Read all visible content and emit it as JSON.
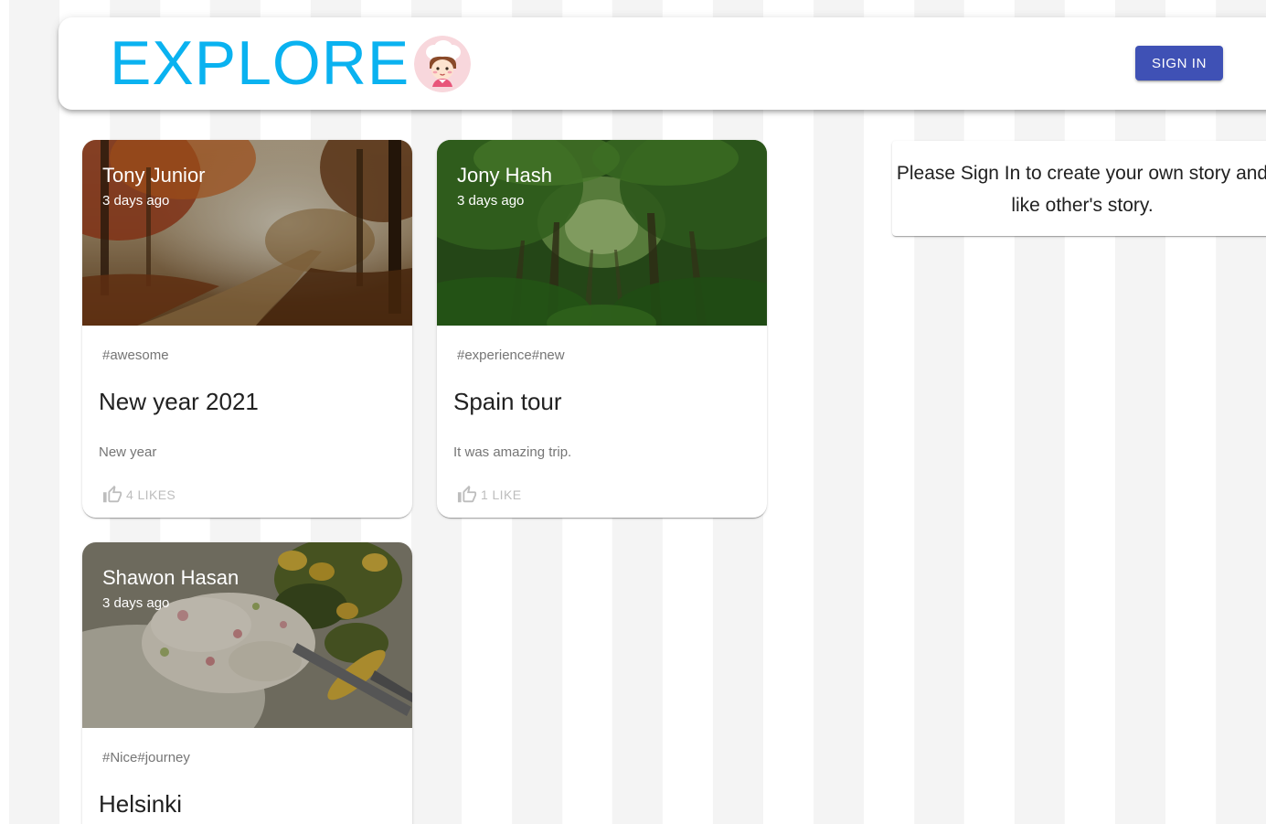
{
  "app": {
    "brand_title": "EXPLORE",
    "brand_color": "#0ab2f0",
    "logo_icon": "chef-avatar-icon",
    "sign_in_label": "SIGN IN",
    "primary_color": "#3f51b5"
  },
  "posts": [
    {
      "author": "Tony Junior",
      "time": "3 days ago",
      "tags": "#awesome",
      "title": "New year 2021",
      "message": "New year",
      "likes_label": "4 LIKES",
      "image_theme": "autumn-forest-path"
    },
    {
      "author": "Jony Hash",
      "time": "3 days ago",
      "tags": "#experience#new",
      "title": "Spain tour",
      "message": "It was amazing trip.",
      "likes_label": "1 LIKE",
      "image_theme": "green-forest"
    },
    {
      "author": "Shawon Hasan",
      "time": "3 days ago",
      "tags": "#Nice#journey",
      "title": "Helsinki",
      "message": "",
      "likes_label": "",
      "image_theme": "salad-and-potatoes"
    }
  ],
  "signin_notice": {
    "text": "Please Sign In to create your own story and like other's story."
  }
}
